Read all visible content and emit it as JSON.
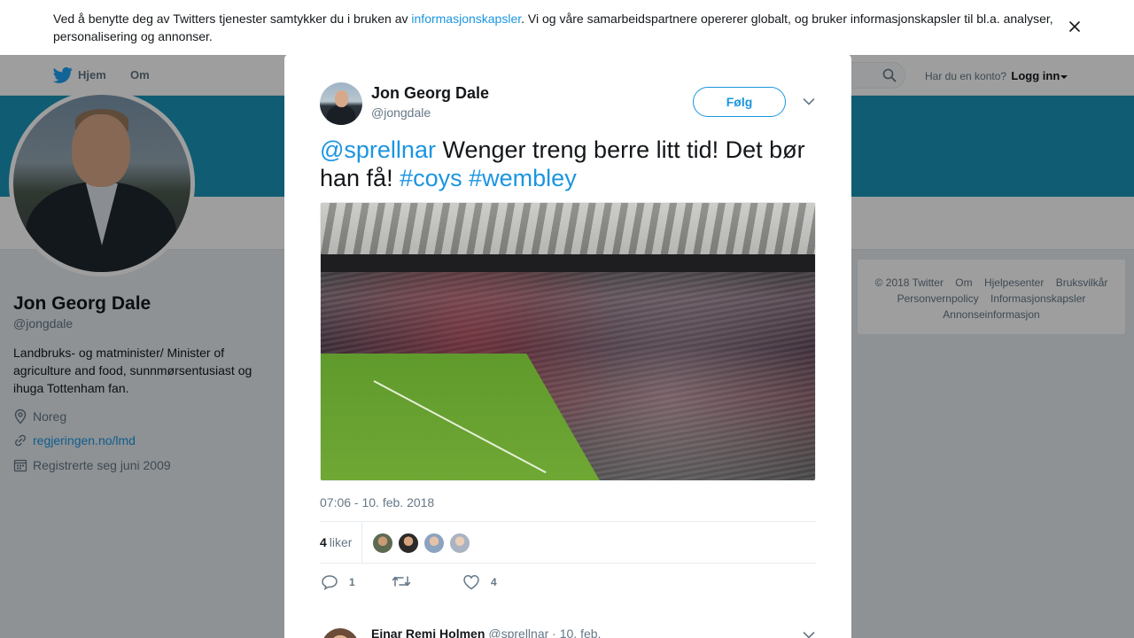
{
  "cookie": {
    "text_before": "Ved å benytte deg av Twitters tjenester samtykker du i bruken av ",
    "link": "informasjonskapsler",
    "text_after": ". Vi og våre samarbeidspartnere opererer globalt, og bruker informasjonskapsler til bl.a. analyser, personalisering og annonser."
  },
  "nav": {
    "home": "Hjem",
    "about": "Om",
    "have_account": "Har du en konto?",
    "login": "Logg inn"
  },
  "profile": {
    "name": "Jon Georg Dale",
    "handle": "@jongdale",
    "bio": "Landbruks- og matminister/ Minister of agriculture and food, sunnmørsentusiast og ihuga Tottenham fan.",
    "location": "Noreg",
    "website": "regjeringen.no/lmd",
    "joined": "Registrerte seg juni 2009"
  },
  "footer": {
    "items": [
      "© 2018 Twitter",
      "Om",
      "Hjelpesenter",
      "Bruksvilkår",
      "Personvernpolicy",
      "Informasjonskapsler",
      "Annonseinformasjon"
    ]
  },
  "tweet": {
    "author_name": "Jon Georg Dale",
    "author_handle": "@jongdale",
    "follow_label": "Følg",
    "mention": "@sprellnar",
    "text_mid": " Wenger treng berre litt tid! Det bør han få! ",
    "hashtag1": "#coys",
    "hashtag2": "#wembley",
    "timestamp": "07:06 - 10. feb. 2018",
    "likes_count": "4",
    "likes_label": "liker",
    "reply_count": "1",
    "like_action_count": "4"
  },
  "reply": {
    "name": "Einar Remi Holmen",
    "handle": "@sprellnar",
    "date": "· 10. feb."
  },
  "colors": {
    "accent": "#1b95e0",
    "banner": "#1b95b8"
  }
}
